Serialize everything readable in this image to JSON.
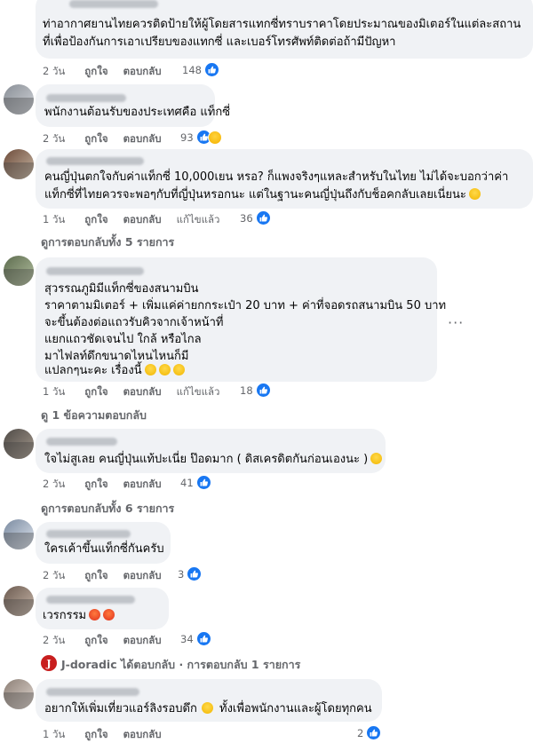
{
  "comments": [
    {
      "lines": [
        "ท่าอากาศยานไทยควรติดป้ายให้ผู้โดยสารแทกซี่ทราบราคาโดยประมาณของมิเตอร์ในแต่ละสถาน",
        "ที่เพื่อป้องกันการเอาเปรียบของแทกซี่ และเบอร์โทรศัพท์ติดต่อถ้ามีปัญหา"
      ],
      "time": "2 วัน",
      "like": "ถูกใจ",
      "reply": "ตอบกลับ",
      "reactions": "148"
    },
    {
      "lines": [
        "พนักงานต้อนรับของประเทศคือ แท็กซี่"
      ],
      "time": "2 วัน",
      "like": "ถูกใจ",
      "reply": "ตอบกลับ",
      "reactions": "93"
    },
    {
      "lines": [
        "คนญี่ปุ่นตกใจกับค่าแท็กซี่ 10,000เยน หรอ? ก็แพงจริงๆแหละสำหรับในไทย ไม่ได้จะบอกว่าค่า",
        "แท็กซี่ที่ไทยควรจะพอๆกับที่ญี่ปุ่นหรอกนะ แต่ในฐานะคนญี่ปุ่นถึงกับช็อคกลับเลยเนี่ยนะ"
      ],
      "time": "1 วัน",
      "like": "ถูกใจ",
      "reply": "ตอบกลับ",
      "edited": "แก้ไขแล้ว",
      "reactions": "36",
      "thread": "ดูการตอบกลับทั้ง 5 รายการ"
    },
    {
      "lines": [
        "สุวรรณภูมิมีแท็กซี่ของสนามบิน",
        "ราคาตามมิเตอร์ + เพิ่มแค่ค่ายกกระเป๋า 20 บาท + ค่าที่จอดรถสนามบิน 50 บาท",
        "จะขึ้นต้องต่อแถวรับคิวจากเจ้าหน้าที่",
        "แยกแถวชัดเจนไป ใกล้ หรือไกล",
        "มาไฟลท์ดึกขนาดไหนไหนก็มี",
        "แปลกๆนะคะ เรื่องนี้"
      ],
      "time": "1 วัน",
      "like": "ถูกใจ",
      "reply": "ตอบกลับ",
      "edited": "แก้ไขแล้ว",
      "reactions": "18",
      "thread": "ดู 1 ข้อความตอบกลับ"
    },
    {
      "lines": [
        "ใจไม่สูเลย คนญี่ปุ่นแท้ปะเนี่ย ป๊อดมาก ( ดิสเครดิตกันก่อนเองนะ )"
      ],
      "time": "2 วัน",
      "like": "ถูกใจ",
      "reply": "ตอบกลับ",
      "reactions": "41",
      "thread": "ดูการตอบกลับทั้ง 6 รายการ"
    },
    {
      "lines": [
        "ใครเค้าขึ้นแท็กซี่กันครับ"
      ],
      "time": "2 วัน",
      "like": "ถูกใจ",
      "reply": "ตอบกลับ",
      "reactions": "3"
    },
    {
      "lines": [
        "เวรกรรม"
      ],
      "time": "2 วัน",
      "like": "ถูกใจ",
      "reply": "ตอบกลับ",
      "reactions": "34",
      "thread_reply": {
        "avatar_letter": "J",
        "name": "J-doradic",
        "rest": " ได้ตอบกลับ · การตอบกลับ 1 รายการ"
      }
    },
    {
      "lines": [
        "อยากให้เพิ่มเที่ยวแอร์ลิงรอบดึก",
        " ทั้งเพื่อพนักงานและผู้โดยทุกคน"
      ],
      "time": "1 วัน",
      "like": "ถูกใจ",
      "reply": "ตอบกลับ",
      "reactions": "2"
    }
  ],
  "colors": {
    "like_blue": "#1877f2",
    "meta_gray": "#65676b",
    "bubble": "#f0f2f5"
  },
  "icons": {
    "like": "thumbs-up-icon",
    "more": "more-options-icon"
  }
}
